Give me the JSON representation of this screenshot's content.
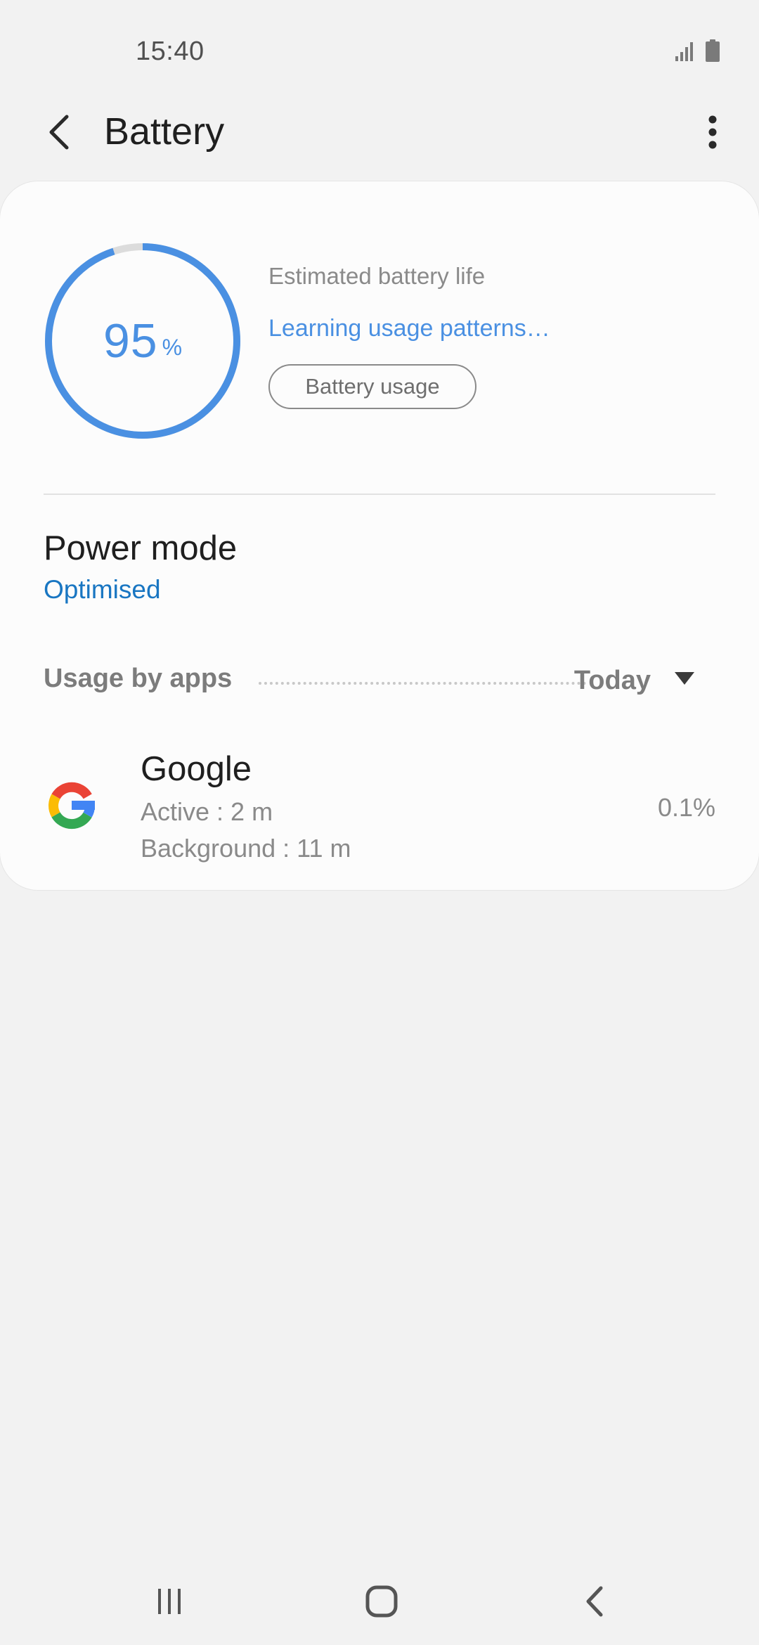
{
  "status_bar": {
    "time": "15:40",
    "icons": [
      "signal-icon",
      "battery-icon"
    ]
  },
  "app_bar": {
    "title": "Battery",
    "back_icon": "back-arrow-icon",
    "menu_icon": "more-vertical-icon"
  },
  "battery": {
    "level_number": "95",
    "level_unit": "%",
    "level_fraction": 0.95,
    "estimated_label": "Estimated battery life",
    "estimate_status": "Learning usage patterns…",
    "usage_button": "Battery usage"
  },
  "power_mode": {
    "title": "Power mode",
    "value": "Optimised"
  },
  "usage_by_apps": {
    "label": "Usage by apps",
    "period": "Today",
    "apps": [
      {
        "name": "Google",
        "active": "Active : 2 m",
        "background": "Background : 11 m",
        "percent": "0.1%",
        "icon": "google-icon"
      }
    ]
  },
  "nav_bar": {
    "buttons": [
      "recents-icon",
      "home-icon",
      "back-icon"
    ]
  },
  "colors": {
    "accent": "#4a90e2",
    "link": "#1976c2",
    "background": "#f2f2f2",
    "card": "#fcfcfc"
  }
}
